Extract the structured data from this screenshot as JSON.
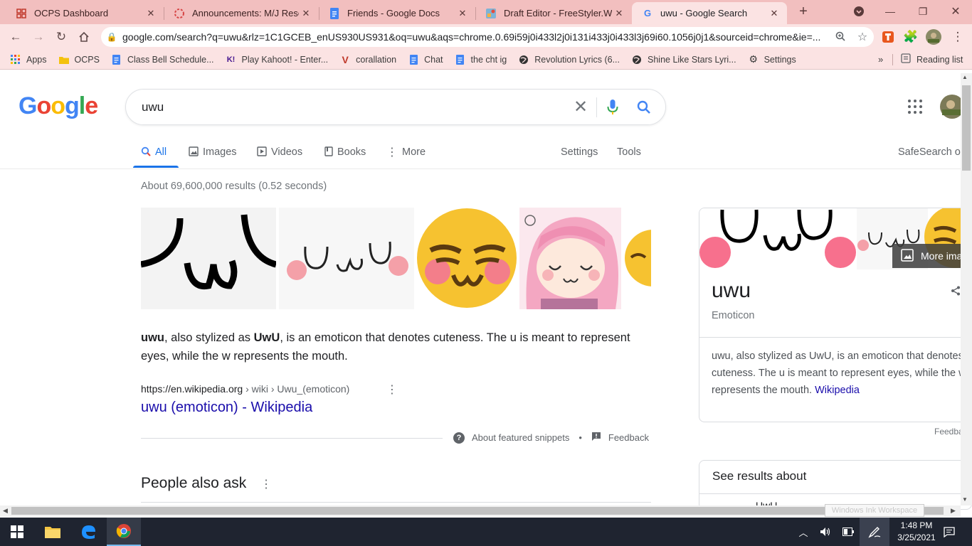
{
  "browser": {
    "tabs": [
      {
        "title": "OCPS Dashboard",
        "icon": "grid-icon"
      },
      {
        "title": "Announcements: M/J Research",
        "icon": "canvas-icon"
      },
      {
        "title": "Friends - Google Docs",
        "icon": "docs-icon"
      },
      {
        "title": "Draft Editor - FreeStyler.WS",
        "icon": "freestyler-icon"
      },
      {
        "title": "uwu - Google Search",
        "icon": "google-icon"
      }
    ],
    "url": "google.com/search?q=uwu&rlz=1C1GCEB_enUS930US931&oq=uwu&aqs=chrome.0.69i59j0i433l2j0i131i433j0i433l3j69i60.1056j0j1&sourceid=chrome&ie=...",
    "bookmarks": [
      {
        "label": "Apps",
        "icon": "apps-grid-icon"
      },
      {
        "label": "OCPS",
        "icon": "folder-icon"
      },
      {
        "label": "Class Bell Schedule...",
        "icon": "docs-icon"
      },
      {
        "label": "Play Kahoot! - Enter...",
        "icon": "kahoot-icon"
      },
      {
        "label": "corallation",
        "icon": "v-icon"
      },
      {
        "label": "Chat",
        "icon": "docs-icon"
      },
      {
        "label": "the cht ig",
        "icon": "docs-icon"
      },
      {
        "label": "Revolution Lyrics (6...",
        "icon": "globe-icon"
      },
      {
        "label": "Shine Like Stars Lyri...",
        "icon": "globe-icon"
      },
      {
        "label": "Settings",
        "icon": "gear-icon"
      }
    ],
    "reading_list": "Reading list"
  },
  "search": {
    "query": "uwu",
    "nav": [
      {
        "label": "All",
        "icon": "search-icon"
      },
      {
        "label": "Images",
        "icon": "image-icon"
      },
      {
        "label": "Videos",
        "icon": "play-icon"
      },
      {
        "label": "Books",
        "icon": "book-icon"
      },
      {
        "label": "More",
        "icon": "more-vert-icon"
      }
    ],
    "settings": "Settings",
    "tools": "Tools",
    "safesearch": "SafeSearch on",
    "result_stats": "About 69,600,000 results (0.52 seconds)"
  },
  "snippet": {
    "t1": "uwu",
    "t2": ", also stylized as ",
    "t3": "UwU",
    "t4": ", is an emoticon that denotes cuteness. The u is meant to represent eyes, while the w represents the mouth.",
    "cite_domain": "https://en.wikipedia.org",
    "cite_path": " › wiki › Uwu_(emoticon)",
    "link": "uwu (emoticon) - Wikipedia",
    "about": "About featured snippets",
    "dot": "•",
    "feedback": "Feedback"
  },
  "people_also_ask": "People also ask",
  "knowledge_panel": {
    "title": "uwu",
    "subtitle": "Emoticon",
    "description": "uwu, also stylized as UwU, is an emoticon that denotes cuteness. The u is meant to represent eyes, while the w represents the mouth.",
    "source": "Wikipedia",
    "more_images": "More images",
    "feedback": "Feedback",
    "see_results": "See results about",
    "see_results_item": "UwU"
  },
  "taskbar": {
    "time": "1:48 PM",
    "date": "3/25/2021",
    "ink_tooltip": "Windows Ink Workspace"
  },
  "colors": {
    "accent": "#1a73e8",
    "link": "#1a0dab",
    "tabstrip": "#f2bfbf",
    "toolbar": "#fbe3e3"
  }
}
